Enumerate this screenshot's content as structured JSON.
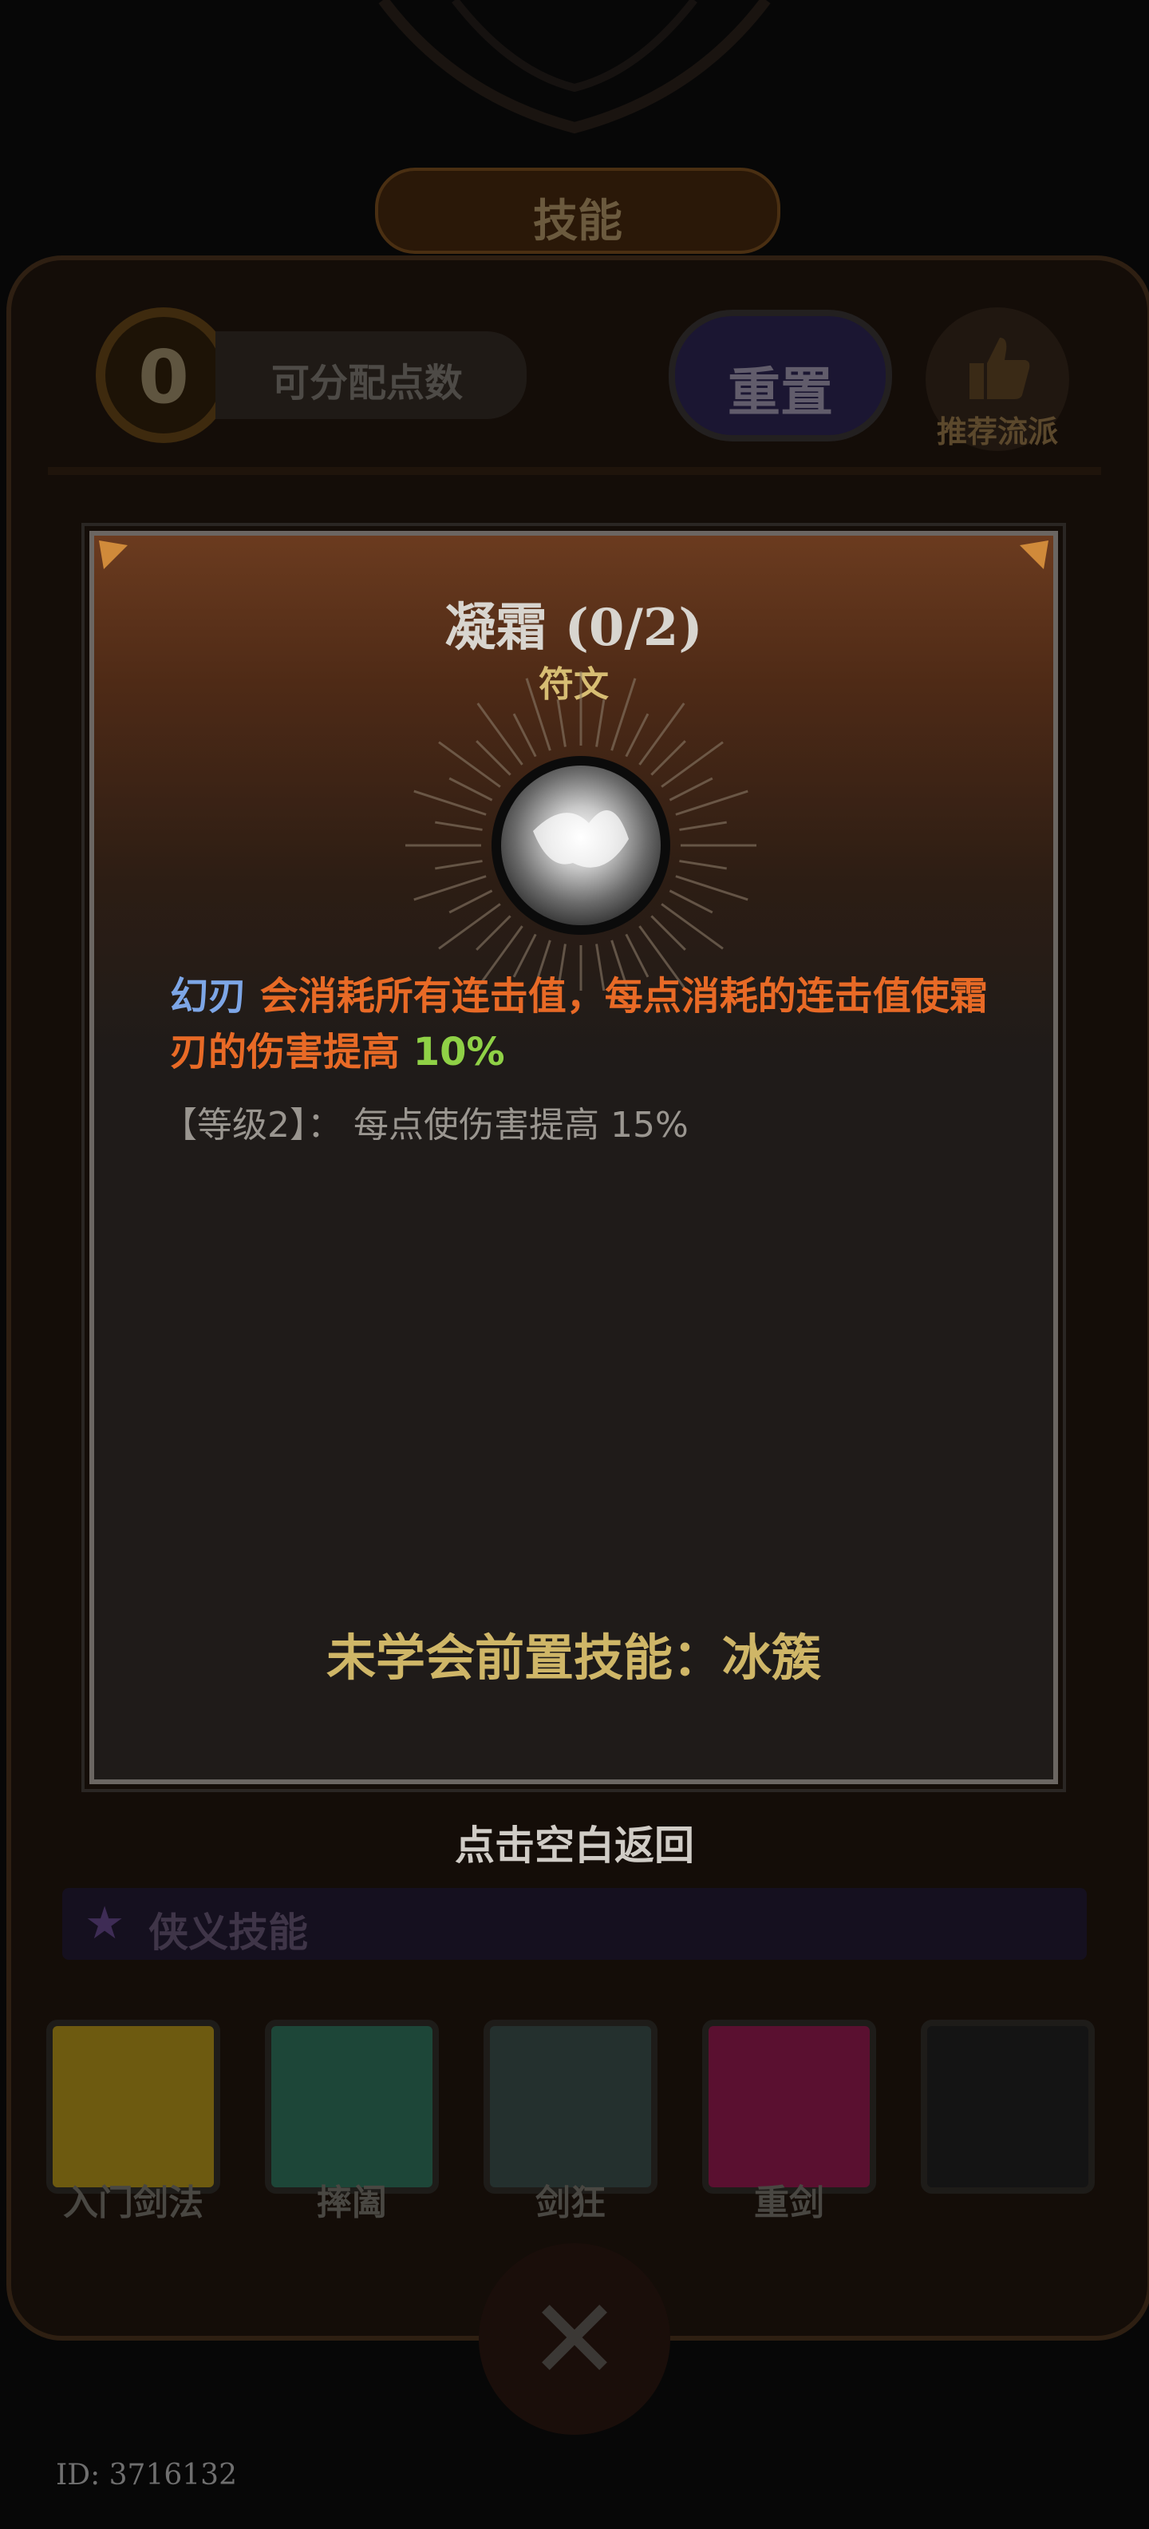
{
  "header": {
    "title": "技能"
  },
  "points": {
    "value": "0",
    "label": "可分配点数"
  },
  "reset_button": {
    "label": "重置"
  },
  "recommend_button": {
    "label": "推荐流派"
  },
  "section": {
    "label": "侠义技能"
  },
  "skills": [
    {
      "label": "入门剑法",
      "color": "#6d5a10"
    },
    {
      "label": "摔阖",
      "color": "#1d4638"
    },
    {
      "label": "剑狂",
      "color": "#24302e"
    },
    {
      "label": "重剑",
      "color": "#5a1030"
    },
    {
      "label": "",
      "color": "#141414"
    }
  ],
  "dialog": {
    "title": "凝霜 (0/2)",
    "type": "符文",
    "icon": "frost-orb-icon",
    "desc_keyword": "幻刃",
    "desc_text": " 会消耗所有连击值，每点消耗的连击值使霜刃的伤害提高 ",
    "desc_value": "10%",
    "level_line": "【等级2】： 每点使伤害提高 15%",
    "prerequisite": "未学会前置技能：冰簇"
  },
  "back_hint": "点击空白返回",
  "player_id": "ID: 3716132",
  "colors": {
    "accent_orange": "#e86a26",
    "keyword_blue": "#7da6e6",
    "value_green": "#8fd146",
    "gold": "#cfb667"
  }
}
